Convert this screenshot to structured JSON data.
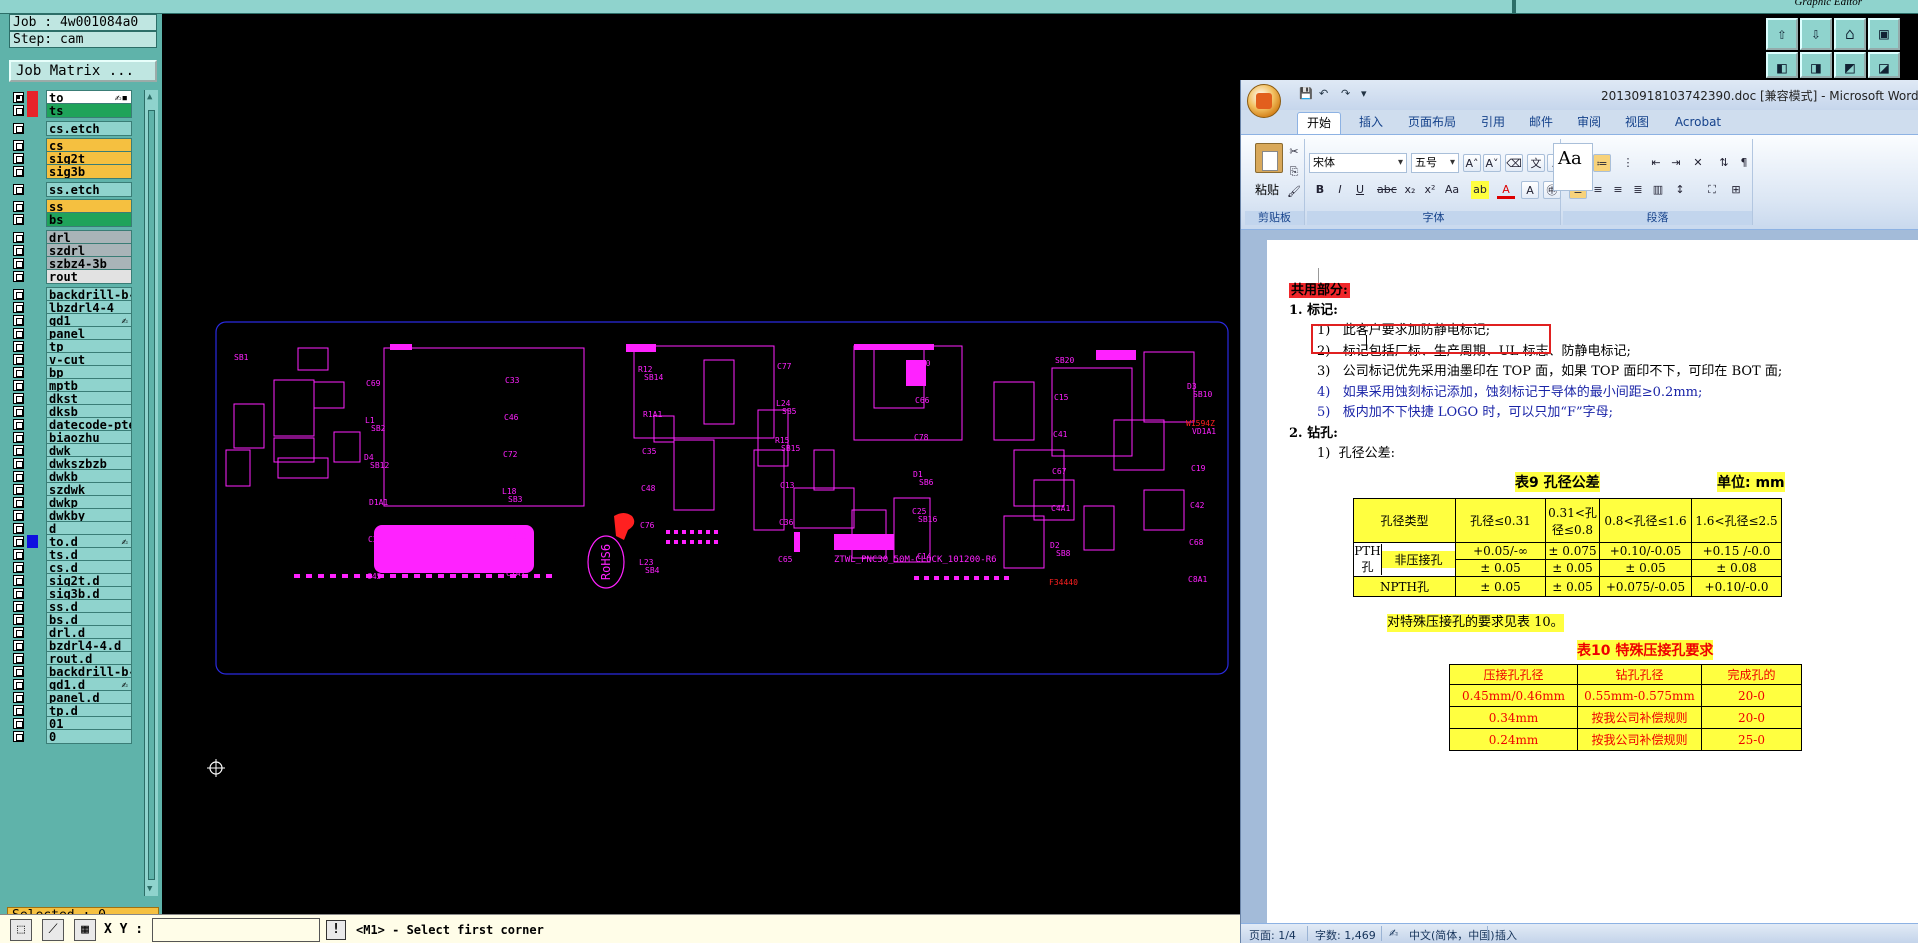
{
  "app": {
    "job": "Job : 4w001084a0",
    "step": "Step: cam",
    "job_matrix": "Job Matrix ...",
    "graphic_editor": "Graphic Editor",
    "selected": "Selected : 0",
    "xy_label": "X Y :",
    "xy_value": "",
    "prompt": "<M1> - Select first corner",
    "excl": "!"
  },
  "layers": [
    {
      "name": "to",
      "color": "#ffffff",
      "swatch": "#e8232a",
      "mark": "✍▪",
      "checked": true
    },
    {
      "name": "ts",
      "color": "#1fa35a",
      "swatch": "#e8232a",
      "mark": ""
    },
    {
      "name": "cs.etch",
      "color": "#8fd3cd",
      "swatch": "",
      "mark": ""
    },
    {
      "name": "cs",
      "color": "#f5c040",
      "swatch": "",
      "mark": ""
    },
    {
      "name": "sig2t",
      "color": "#f5c040",
      "swatch": "",
      "mark": ""
    },
    {
      "name": "sig3b",
      "color": "#f5c040",
      "swatch": "",
      "mark": ""
    },
    {
      "name": "ss.etch",
      "color": "#8fd3cd",
      "swatch": "",
      "mark": ""
    },
    {
      "name": "ss",
      "color": "#f5c040",
      "swatch": "",
      "mark": ""
    },
    {
      "name": "bs",
      "color": "#1fa35a",
      "swatch": "",
      "mark": ""
    },
    {
      "name": "drl",
      "color": "#a9b4b8",
      "swatch": "",
      "mark": ""
    },
    {
      "name": "szdrl",
      "color": "#a9b4b8",
      "swatch": "",
      "mark": ""
    },
    {
      "name": "szbz4-3b",
      "color": "#a9b4b8",
      "swatch": "",
      "mark": ""
    },
    {
      "name": "rout",
      "color": "#e2e2e2",
      "swatch": "",
      "mark": ""
    },
    {
      "name": "backdrill-b-",
      "color": "#8fd3cd",
      "swatch": "",
      "mark": ""
    },
    {
      "name": "lbzdrl4-4",
      "color": "#8fd3cd",
      "swatch": "",
      "mark": ""
    },
    {
      "name": "gd1",
      "color": "#8fd3cd",
      "swatch": "",
      "mark": "✍"
    },
    {
      "name": "panel",
      "color": "#8fd3cd",
      "swatch": "",
      "mark": ""
    },
    {
      "name": "tp",
      "color": "#8fd3cd",
      "swatch": "",
      "mark": ""
    },
    {
      "name": "v-cut",
      "color": "#8fd3cd",
      "swatch": "",
      "mark": ""
    },
    {
      "name": "bp",
      "color": "#8fd3cd",
      "swatch": "",
      "mark": ""
    },
    {
      "name": "mptb",
      "color": "#8fd3cd",
      "swatch": "",
      "mark": ""
    },
    {
      "name": "dkst",
      "color": "#8fd3cd",
      "swatch": "",
      "mark": ""
    },
    {
      "name": "dksb",
      "color": "#8fd3cd",
      "swatch": "",
      "mark": ""
    },
    {
      "name": "datecode-pte",
      "color": "#8fd3cd",
      "swatch": "",
      "mark": ""
    },
    {
      "name": "biaozhu",
      "color": "#8fd3cd",
      "swatch": "",
      "mark": ""
    },
    {
      "name": "dwk",
      "color": "#8fd3cd",
      "swatch": "",
      "mark": ""
    },
    {
      "name": "dwkszbzb",
      "color": "#8fd3cd",
      "swatch": "",
      "mark": ""
    },
    {
      "name": "dwkb",
      "color": "#8fd3cd",
      "swatch": "",
      "mark": ""
    },
    {
      "name": "szdwk",
      "color": "#8fd3cd",
      "swatch": "",
      "mark": ""
    },
    {
      "name": "dwkp",
      "color": "#8fd3cd",
      "swatch": "",
      "mark": ""
    },
    {
      "name": "dwkby",
      "color": "#8fd3cd",
      "swatch": "",
      "mark": ""
    },
    {
      "name": "d",
      "color": "#8fd3cd",
      "swatch": "",
      "mark": ""
    },
    {
      "name": "to.d",
      "color": "#8fd3cd",
      "swatch": "#1010e0",
      "mark": "✍"
    },
    {
      "name": "ts.d",
      "color": "#8fd3cd",
      "swatch": "",
      "mark": ""
    },
    {
      "name": "cs.d",
      "color": "#8fd3cd",
      "swatch": "",
      "mark": ""
    },
    {
      "name": "sig2t.d",
      "color": "#8fd3cd",
      "swatch": "",
      "mark": ""
    },
    {
      "name": "sig3b.d",
      "color": "#8fd3cd",
      "swatch": "",
      "mark": ""
    },
    {
      "name": "ss.d",
      "color": "#8fd3cd",
      "swatch": "",
      "mark": ""
    },
    {
      "name": "bs.d",
      "color": "#8fd3cd",
      "swatch": "",
      "mark": ""
    },
    {
      "name": "drl.d",
      "color": "#8fd3cd",
      "swatch": "",
      "mark": ""
    },
    {
      "name": "bzdrl4-4.d",
      "color": "#8fd3cd",
      "swatch": "",
      "mark": ""
    },
    {
      "name": "rout.d",
      "color": "#8fd3cd",
      "swatch": "",
      "mark": ""
    },
    {
      "name": "backdrill-b-",
      "color": "#8fd3cd",
      "swatch": "",
      "mark": ""
    },
    {
      "name": "gd1.d",
      "color": "#8fd3cd",
      "swatch": "",
      "mark": "✍"
    },
    {
      "name": "panel.d",
      "color": "#8fd3cd",
      "swatch": "",
      "mark": ""
    },
    {
      "name": "tp.d",
      "color": "#8fd3cd",
      "swatch": "",
      "mark": ""
    },
    {
      "name": "01",
      "color": "#8fd3cd",
      "swatch": "",
      "mark": ""
    },
    {
      "name": "0",
      "color": "#8fd3cd",
      "swatch": "",
      "mark": ""
    }
  ],
  "pcb": {
    "outline_color": "#2a2ae0",
    "silk_color": "#ff22ff",
    "highlight_color": "#ff2020",
    "board_label": "ZTWL_PNC30_50M-CLOCK_101200-R6",
    "rohs": "RoHS6",
    "labels": [
      {
        "t": "SB1",
        "k": "a"
      },
      {
        "t": "SB2",
        "k": "b"
      },
      {
        "t": "SB3",
        "k": "c"
      },
      {
        "t": "SB4",
        "k": "d"
      },
      {
        "t": "SB5",
        "k": "e"
      },
      {
        "t": "SB6",
        "k": "f"
      },
      {
        "t": "SB8",
        "k": "g"
      },
      {
        "t": "SB10",
        "k": "h"
      },
      {
        "t": "SB12",
        "k": "i"
      },
      {
        "t": "SB13",
        "k": "j"
      },
      {
        "t": "SB14",
        "k": "k"
      },
      {
        "t": "SB15",
        "k": "l"
      },
      {
        "t": "SB16",
        "k": "m"
      },
      {
        "t": "SB20",
        "k": "n"
      },
      {
        "t": "VD1A1",
        "k": "o"
      },
      {
        "t": "D1A1",
        "k": "p"
      },
      {
        "t": "C7A1",
        "k": "q"
      },
      {
        "t": "R1A1",
        "k": "r"
      },
      {
        "t": "C13",
        "k": "s"
      },
      {
        "t": "C14",
        "k": "t"
      },
      {
        "t": "C15",
        "k": "u"
      },
      {
        "t": "C19",
        "k": "v"
      },
      {
        "t": "C26",
        "k": "w"
      },
      {
        "t": "C33",
        "k": "x"
      },
      {
        "t": "C35",
        "k": "y"
      },
      {
        "t": "C36",
        "k": "z"
      },
      {
        "t": "C40",
        "k": "aa"
      },
      {
        "t": "C41",
        "k": "ab"
      },
      {
        "t": "C42",
        "k": "ac"
      },
      {
        "t": "C45",
        "k": "ad"
      },
      {
        "t": "C46",
        "k": "ae"
      },
      {
        "t": "C48",
        "k": "af"
      },
      {
        "t": "C65",
        "k": "ag"
      },
      {
        "t": "C66",
        "k": "ah"
      },
      {
        "t": "C67",
        "k": "ai"
      },
      {
        "t": "C68",
        "k": "aj"
      },
      {
        "t": "C69",
        "k": "ak"
      },
      {
        "t": "C72",
        "k": "al"
      },
      {
        "t": "C76",
        "k": "am"
      },
      {
        "t": "C77",
        "k": "an"
      },
      {
        "t": "C78",
        "k": "ao"
      },
      {
        "t": "C4A1",
        "k": "ap"
      },
      {
        "t": "C8A1",
        "k": "aq"
      },
      {
        "t": "L1",
        "k": "ar"
      },
      {
        "t": "L18",
        "k": "as"
      },
      {
        "t": "L23",
        "k": "at"
      },
      {
        "t": "L24",
        "k": "au"
      },
      {
        "t": "D1",
        "k": "av"
      },
      {
        "t": "D2",
        "k": "aw"
      },
      {
        "t": "D3",
        "k": "ax"
      },
      {
        "t": "D4",
        "k": "ay"
      },
      {
        "t": "R7",
        "k": "az"
      },
      {
        "t": "R12",
        "k": "ba"
      },
      {
        "t": "R15",
        "k": "bb"
      },
      {
        "t": "C25",
        "k": "bc"
      },
      {
        "t": "F34440",
        "k": "bd"
      },
      {
        "t": "W1594Z",
        "k": "be"
      }
    ]
  },
  "word": {
    "title": "20130918103742390.doc [兼容模式] - Microsoft Word",
    "tabs": [
      "开始",
      "插入",
      "页面布局",
      "引用",
      "邮件",
      "审阅",
      "视图",
      "Acrobat"
    ],
    "paste": "粘贴",
    "font_name": "宋体",
    "font_size": "五号",
    "groups": {
      "clipboard": "剪贴板",
      "font": "字体",
      "paragraph": "段落"
    },
    "style_preview": "Aa",
    "doc": {
      "header": "共用部分:",
      "h1": "1.    标记:",
      "items1": [
        {
          "n": "1)",
          "t": "此客户要求加防静电标记;",
          "blue": false
        },
        {
          "n": "2)",
          "t": "标记包括厂标、生产周期、UL 标志、防静电标记;",
          "blue": false
        },
        {
          "n": "3)",
          "t": "公司标记优先采用油墨印在 TOP 面，如果 TOP 面印不下，可印在 BOT 面;",
          "blue": false
        },
        {
          "n": "4)",
          "t": "如果采用蚀刻标记添加，蚀刻标记于导体的最小间距≥0.2mm;",
          "blue": true
        },
        {
          "n": "5)",
          "t": "板内加不下快捷 LOGO 时，可以只加“F”字母;",
          "blue": true
        }
      ],
      "h2": "2.    钻孔:",
      "item2": {
        "n": "1)",
        "t": "孔径公差:"
      },
      "table9": {
        "caption": "表9    孔径公差",
        "unit": "单位: mm",
        "headers": [
          "孔径类型",
          "孔径≤0.31",
          "0.31<孔径≤0.8",
          "0.8<孔径≤1.6",
          "1.6<孔径≤2.5"
        ],
        "pth": "PTH孔",
        "rows": [
          [
            "非压接孔",
            "+0.05/-∞",
            "± 0.075",
            "+0.10/-0.05",
            "+0.15 /-0.0"
          ],
          [
            "压接孔",
            "± 0.05",
            "± 0.05",
            "± 0.05",
            "± 0.08"
          ],
          [
            "NPTH孔",
            "± 0.05",
            "± 0.05",
            "+0.075/-0.05",
            "+0.10/-0.0"
          ]
        ]
      },
      "note10": "对特殊压接孔的要求见表 10。",
      "table10": {
        "caption": "表10    特殊压接孔要求",
        "headers": [
          "压接孔孔径",
          "钻孔孔径",
          "完成孔的"
        ],
        "rows": [
          [
            "0.45mm/0.46mm",
            "0.55mm-0.575mm",
            "20-0"
          ],
          [
            "0.34mm",
            "按我公司补偿规则",
            "20-0"
          ],
          [
            "0.24mm",
            "按我公司补偿规则",
            "25-0"
          ]
        ]
      }
    },
    "status": {
      "page": "页面: 1/4",
      "words": "字数: 1,469",
      "lang": "中文(简体，中国)",
      "mode": "插入"
    }
  }
}
